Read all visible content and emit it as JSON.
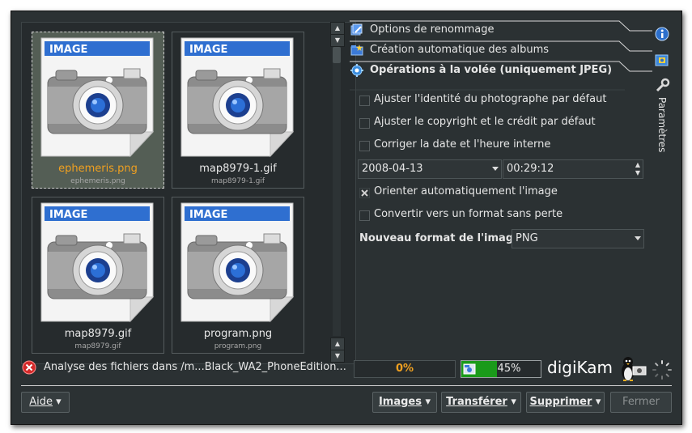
{
  "thumbnails": [
    {
      "name": "ephemeris.png",
      "sub": "ephemeris.png",
      "selected": true,
      "badge": "IMAGE"
    },
    {
      "name": "map8979-1.gif",
      "sub": "map8979-1.gif",
      "selected": false,
      "badge": "IMAGE"
    },
    {
      "name": "map8979.gif",
      "sub": "map8979.gif",
      "selected": false,
      "badge": "IMAGE"
    },
    {
      "name": "program.png",
      "sub": "program.png",
      "selected": false,
      "badge": "IMAGE"
    }
  ],
  "sections": [
    {
      "label": "Options de renommage",
      "icon": "rename-icon"
    },
    {
      "label": "Création automatique des albums",
      "icon": "album-create-icon"
    },
    {
      "label": "Opérations à la volée (uniquement JPEG)",
      "icon": "gear-icon"
    }
  ],
  "options": {
    "photographer": {
      "label": "Ajuster l'identité du photographe par défaut",
      "checked": false
    },
    "copyright": {
      "label": "Ajuster le copyright et le crédit par défaut",
      "checked": false
    },
    "fix_date": {
      "label": "Corriger la date et l'heure interne",
      "checked": false
    },
    "date_value": "2008-04-13",
    "time_value": "00:29:12",
    "auto_rotate": {
      "label": "Orienter automatiquement l'image",
      "checked": true
    },
    "lossless": {
      "label": "Convertir vers un format sans perte",
      "checked": false
    },
    "format_label": "Nouveau format de l'image :",
    "format_value": "PNG"
  },
  "side_tabs": {
    "settings_label": "Paramètres",
    "info_icon": "info-icon",
    "camera_icon": "camera-settings-icon",
    "wrench_icon": "wrench-icon"
  },
  "status": {
    "text": "Analyse des fichiers dans /m...Black_WA2_PhoneEdition...",
    "progress1_text": "0%",
    "progress1_value": 0,
    "progress2_text": "45%",
    "progress2_value": 45,
    "app_name": "digiKam",
    "colors": {
      "progress_fill": "#1a9a1a",
      "progress_text_orange": "#f0a020"
    }
  },
  "buttons": {
    "help": "Aide",
    "images": "Images",
    "transfer": "Transférer",
    "delete": "Supprimer",
    "close": "Fermer"
  }
}
